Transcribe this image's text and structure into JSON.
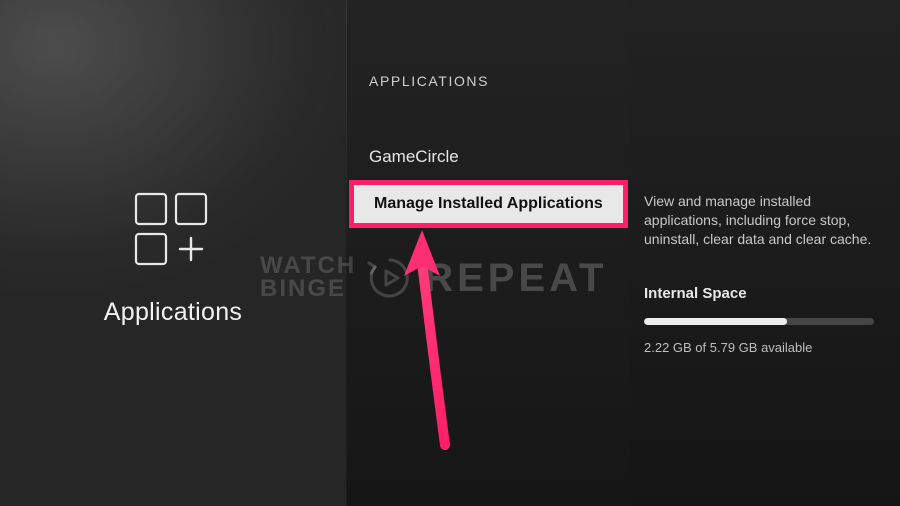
{
  "left": {
    "label": "Applications"
  },
  "center": {
    "heading": "APPLICATIONS",
    "items": [
      {
        "label": "GameCircle"
      },
      {
        "label": "Manage Installed Applications"
      }
    ]
  },
  "detail": {
    "description": "View and manage installed applications, including force stop, uninstall, clear data and clear cache.",
    "storage_title": "Internal Space",
    "storage_text": "2.22 GB of 5.79 GB available",
    "storage_used_pct": 62
  },
  "watermark": {
    "line1": "WATCH",
    "line2": "BINGE",
    "line3": "REPEAT"
  },
  "colors": {
    "highlight": "#ff1f66"
  }
}
